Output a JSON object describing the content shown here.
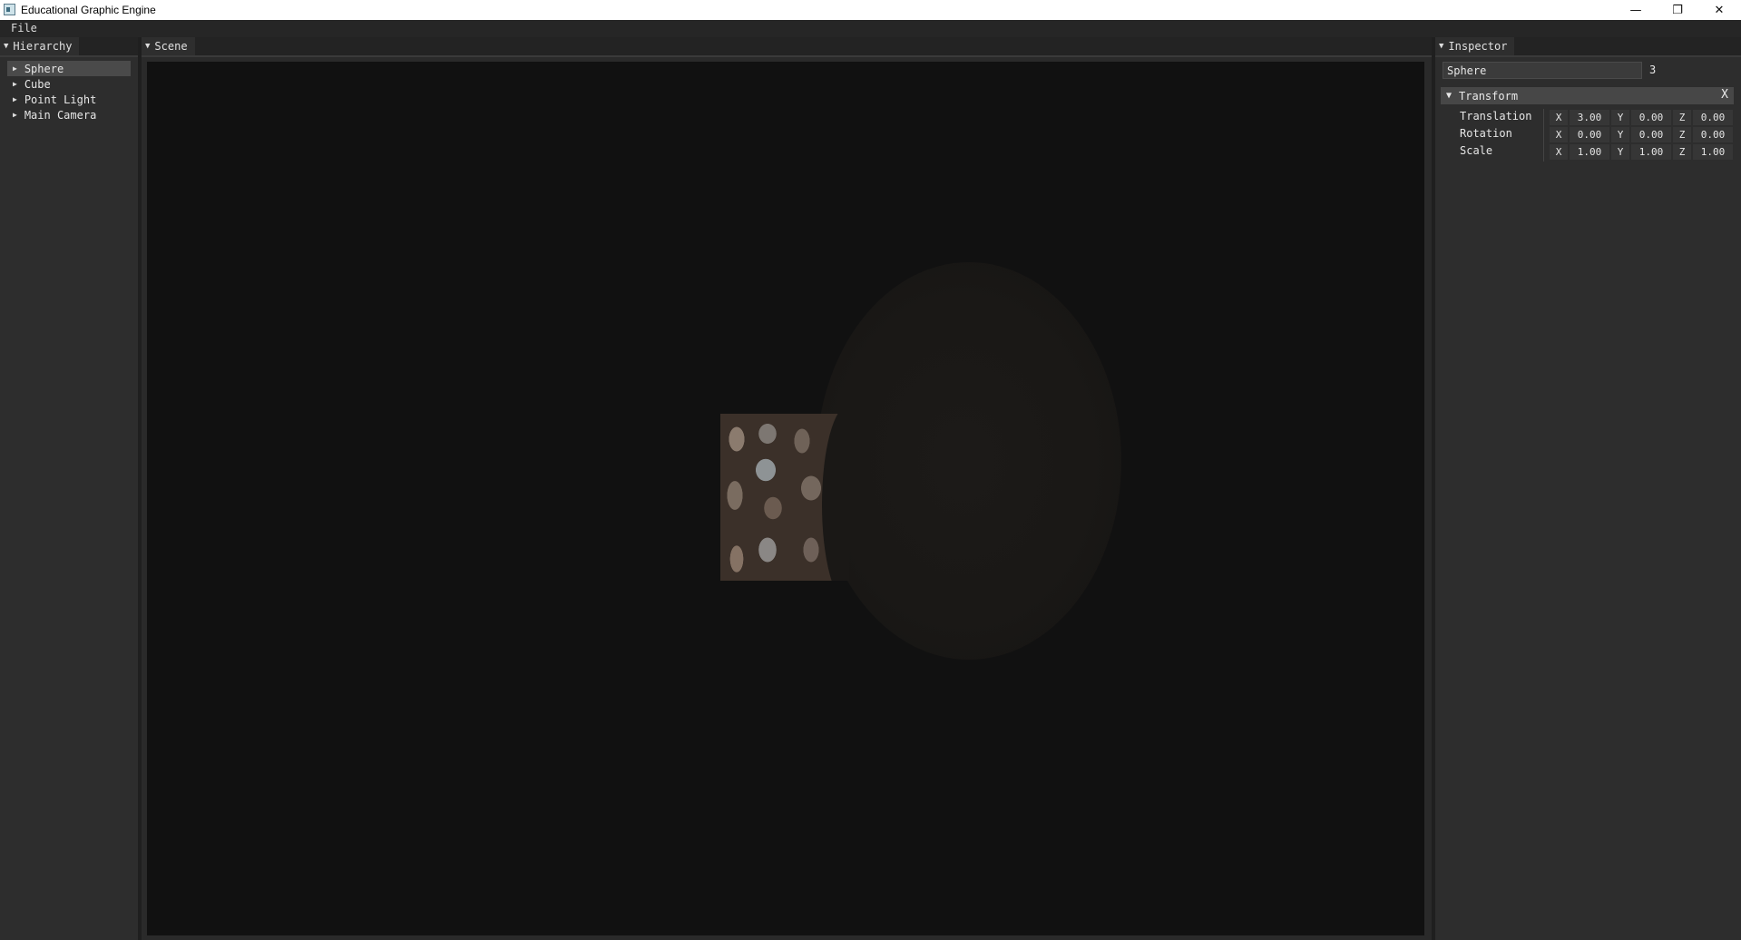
{
  "window": {
    "title": "Educational Graphic Engine"
  },
  "menu": {
    "items": [
      "File"
    ]
  },
  "hierarchy": {
    "tab_label": "Hierarchy",
    "items": [
      {
        "label": "Sphere",
        "selected": true
      },
      {
        "label": "Cube",
        "selected": false
      },
      {
        "label": "Point Light",
        "selected": false
      },
      {
        "label": "Main Camera",
        "selected": false
      }
    ]
  },
  "scene": {
    "tab_label": "Scene"
  },
  "inspector": {
    "tab_label": "Inspector",
    "object_name": "Sphere",
    "object_id": "3",
    "component": "Transform",
    "close_glyph": "X",
    "properties": [
      {
        "label": "Translation",
        "x": "3.00",
        "y": "0.00",
        "z": "0.00"
      },
      {
        "label": "Rotation",
        "x": "0.00",
        "y": "0.00",
        "z": "0.00"
      },
      {
        "label": "Scale",
        "x": "1.00",
        "y": "1.00",
        "z": "1.00"
      }
    ],
    "axis_labels": {
      "x": "X",
      "y": "Y",
      "z": "Z"
    }
  },
  "colors": {
    "background": "#2b2b2b",
    "viewport": "#111111",
    "selection": "#4a4a4a",
    "header": "#474747"
  }
}
